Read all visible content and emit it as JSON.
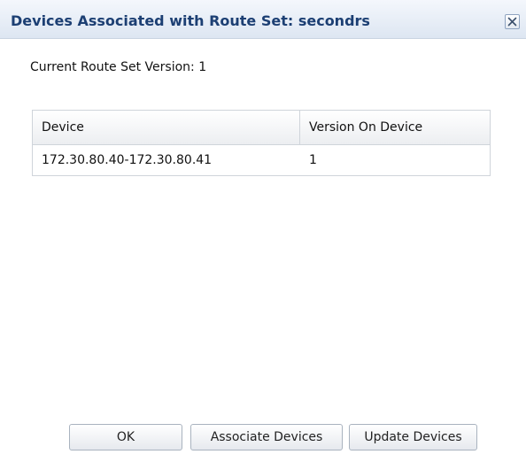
{
  "dialog": {
    "title": "Devices Associated with Route Set: secondrs",
    "close_icon": "close-icon"
  },
  "summary": {
    "version_text": "Current Route Set Version: 1"
  },
  "table": {
    "columns": [
      "Device",
      "Version On Device"
    ],
    "rows": [
      [
        "172.30.80.40-172.30.80.41",
        "1"
      ]
    ]
  },
  "buttons": {
    "ok_label": "OK",
    "associate_label": "Associate Devices",
    "update_label": "Update Devices"
  },
  "colors": {
    "title_text": "#1c3f73",
    "titlebar_bg": "#dde6f2",
    "border": "#cfd4da"
  }
}
